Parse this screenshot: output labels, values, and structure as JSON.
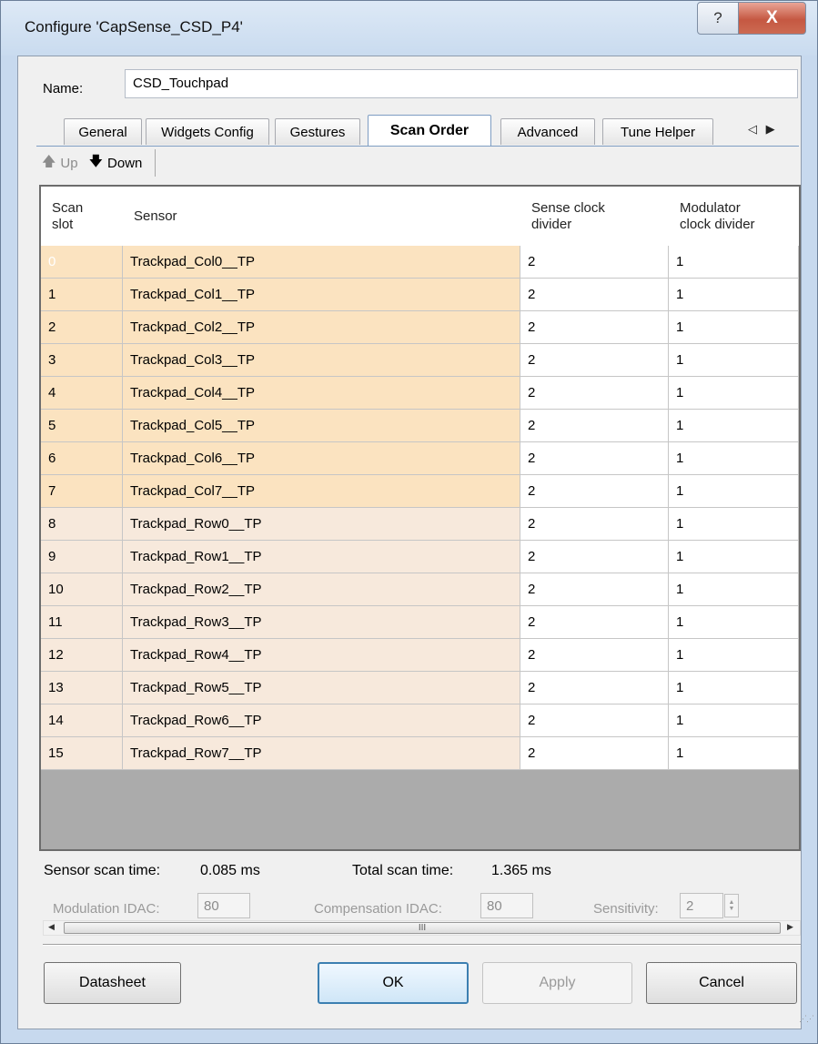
{
  "window": {
    "title": "Configure 'CapSense_CSD_P4'",
    "help_glyph": "?",
    "close_glyph": "X"
  },
  "name_field": {
    "label": "Name:",
    "value": "CSD_Touchpad"
  },
  "tabs": [
    {
      "label": "General"
    },
    {
      "label": "Widgets Config"
    },
    {
      "label": "Gestures"
    },
    {
      "label": "Scan Order",
      "active": true
    },
    {
      "label": "Advanced"
    },
    {
      "label": "Tune Helper"
    }
  ],
  "tab_scroll_glyphs": "◁ ▶",
  "toolbar": {
    "up_icon": "arrow-up-icon",
    "up_label": "Up",
    "down_icon": "arrow-down-icon",
    "down_label": "Down"
  },
  "table": {
    "columns": [
      "Scan\nslot",
      "Sensor",
      "Sense clock\ndivider",
      "Modulator\nclock divider"
    ],
    "selected_row": 0,
    "rows": [
      {
        "slot": "0",
        "sensor": "Trackpad_Col0__TP",
        "sense_div": "2",
        "mod_div": "1"
      },
      {
        "slot": "1",
        "sensor": "Trackpad_Col1__TP",
        "sense_div": "2",
        "mod_div": "1"
      },
      {
        "slot": "2",
        "sensor": "Trackpad_Col2__TP",
        "sense_div": "2",
        "mod_div": "1"
      },
      {
        "slot": "3",
        "sensor": "Trackpad_Col3__TP",
        "sense_div": "2",
        "mod_div": "1"
      },
      {
        "slot": "4",
        "sensor": "Trackpad_Col4__TP",
        "sense_div": "2",
        "mod_div": "1"
      },
      {
        "slot": "5",
        "sensor": "Trackpad_Col5__TP",
        "sense_div": "2",
        "mod_div": "1"
      },
      {
        "slot": "6",
        "sensor": "Trackpad_Col6__TP",
        "sense_div": "2",
        "mod_div": "1"
      },
      {
        "slot": "7",
        "sensor": "Trackpad_Col7__TP",
        "sense_div": "2",
        "mod_div": "1"
      },
      {
        "slot": "8",
        "sensor": "Trackpad_Row0__TP",
        "sense_div": "2",
        "mod_div": "1"
      },
      {
        "slot": "9",
        "sensor": "Trackpad_Row1__TP",
        "sense_div": "2",
        "mod_div": "1"
      },
      {
        "slot": "10",
        "sensor": "Trackpad_Row2__TP",
        "sense_div": "2",
        "mod_div": "1"
      },
      {
        "slot": "11",
        "sensor": "Trackpad_Row3__TP",
        "sense_div": "2",
        "mod_div": "1"
      },
      {
        "slot": "12",
        "sensor": "Trackpad_Row4__TP",
        "sense_div": "2",
        "mod_div": "1"
      },
      {
        "slot": "13",
        "sensor": "Trackpad_Row5__TP",
        "sense_div": "2",
        "mod_div": "1"
      },
      {
        "slot": "14",
        "sensor": "Trackpad_Row6__TP",
        "sense_div": "2",
        "mod_div": "1"
      },
      {
        "slot": "15",
        "sensor": "Trackpad_Row7__TP",
        "sense_div": "2",
        "mod_div": "1"
      }
    ],
    "col_row_color": "#fbe3c0",
    "row_row_color": "#f7e9dc"
  },
  "scan_times": {
    "sensor_label": "Sensor scan time:",
    "sensor_value": "0.085 ms",
    "total_label": "Total scan time:",
    "total_value": "1.365 ms"
  },
  "tuning": {
    "mod_idac_label": "Modulation IDAC:",
    "mod_idac_value": "80",
    "comp_idac_label": "Compensation IDAC:",
    "comp_idac_value": "80",
    "sensitivity_label": "Sensitivity:",
    "sensitivity_value": "2"
  },
  "scrollbar": {
    "left_glyph": "◀",
    "right_glyph": "▶",
    "thumb_glyph": "III"
  },
  "buttons": {
    "datasheet": "Datasheet",
    "ok": "OK",
    "apply": "Apply",
    "cancel": "Cancel"
  }
}
